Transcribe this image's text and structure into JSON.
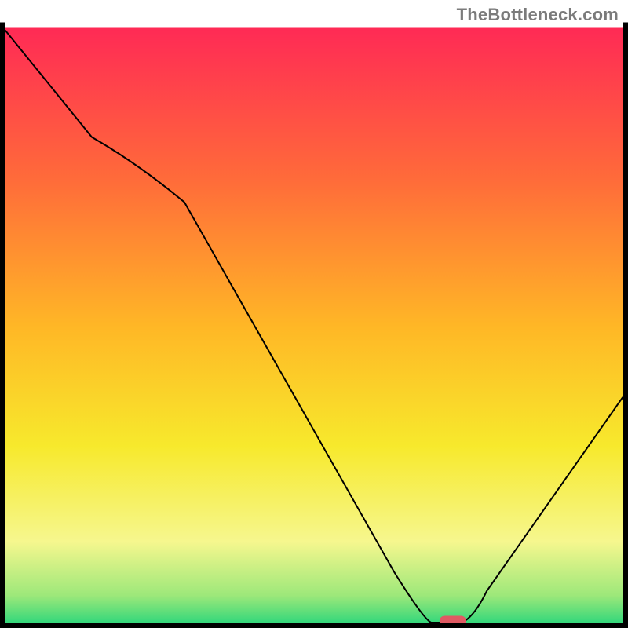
{
  "watermark": "TheBottleneck.com",
  "chart_data": {
    "type": "line",
    "title": "",
    "xlabel": "",
    "ylabel": "",
    "x": [
      0,
      14,
      29,
      69,
      71,
      74,
      100
    ],
    "y": [
      100,
      82,
      71,
      0,
      0,
      0,
      38
    ],
    "xlim": [
      0,
      100
    ],
    "ylim": [
      0,
      100
    ],
    "marker": {
      "x": 72.5,
      "y": 0,
      "color": "#e05a63"
    },
    "curve_color": "#000000",
    "curve_width": 2,
    "background_gradient": {
      "stops": [
        {
          "offset": 0.0,
          "color": "#ff2a55"
        },
        {
          "offset": 0.25,
          "color": "#ff6a3a"
        },
        {
          "offset": 0.5,
          "color": "#ffb726"
        },
        {
          "offset": 0.7,
          "color": "#f7e92c"
        },
        {
          "offset": 0.86,
          "color": "#f6f78e"
        },
        {
          "offset": 0.95,
          "color": "#9de87a"
        },
        {
          "offset": 1.0,
          "color": "#2bd67b"
        }
      ]
    },
    "frame_color": "#000000",
    "frame_width": 7,
    "top_frame_gap": 32
  }
}
